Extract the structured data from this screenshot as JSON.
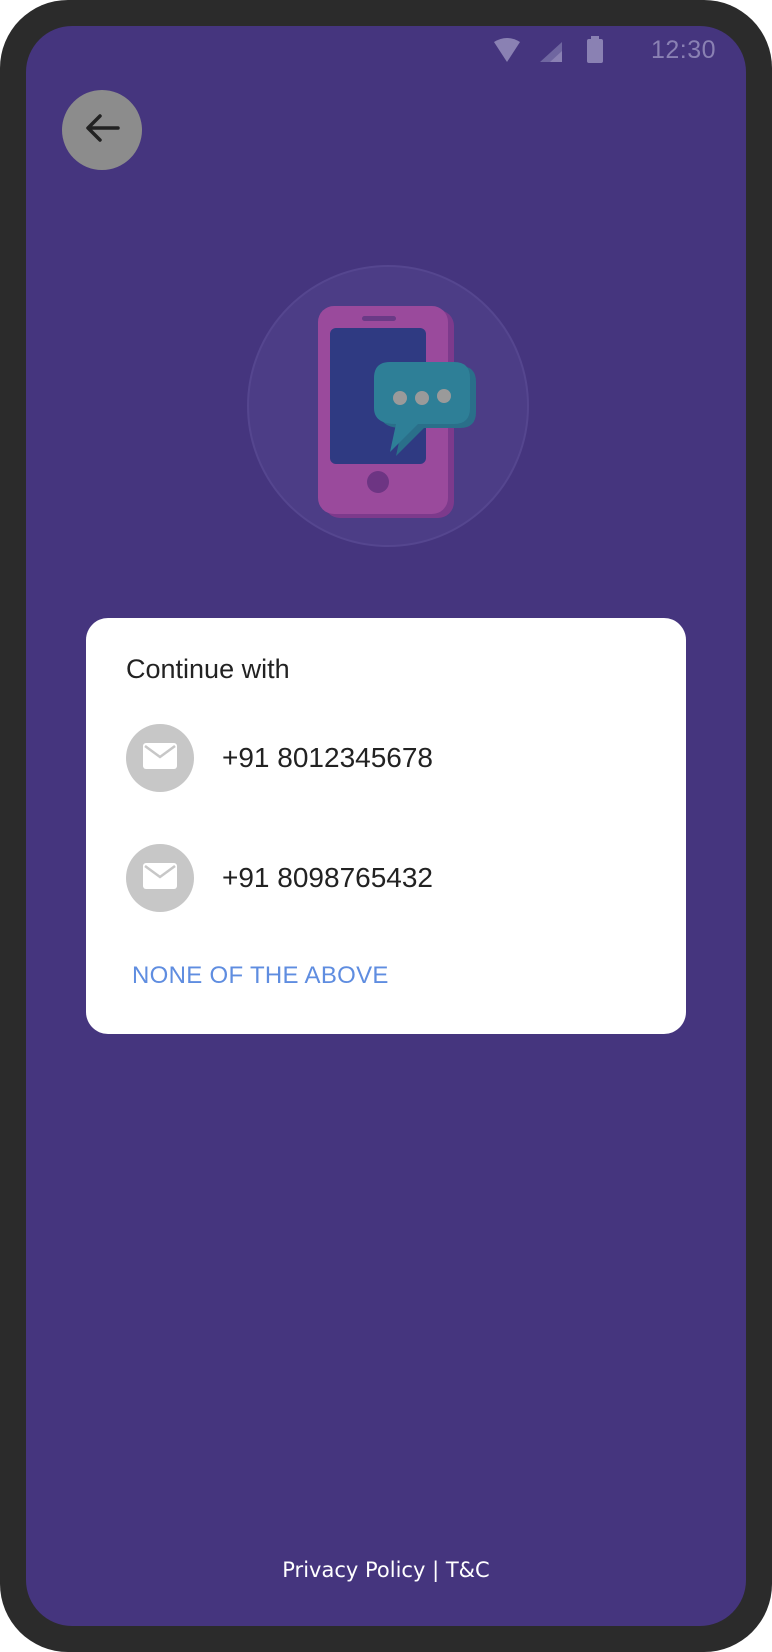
{
  "status_bar": {
    "time": "12:30",
    "icons": [
      "wifi-icon",
      "cellular-signal-icon",
      "battery-icon"
    ]
  },
  "header": {
    "back_icon": "arrow-left-icon"
  },
  "illustration": {
    "icon": "phone-chat-illustration"
  },
  "dialog": {
    "title": "Continue with",
    "options": [
      {
        "icon": "mail-icon",
        "label": "+91 8012345678"
      },
      {
        "icon": "mail-icon",
        "label": "+91 8098765432"
      }
    ],
    "none_label": "NONE OF THE ABOVE"
  },
  "footer": {
    "privacy_label": "Privacy Policy",
    "separator": "|",
    "terms_label": "T&C"
  },
  "colors": {
    "background": "#45357e",
    "frame": "#2b2b2b",
    "link": "#5f8de0",
    "card": "#ffffff"
  }
}
